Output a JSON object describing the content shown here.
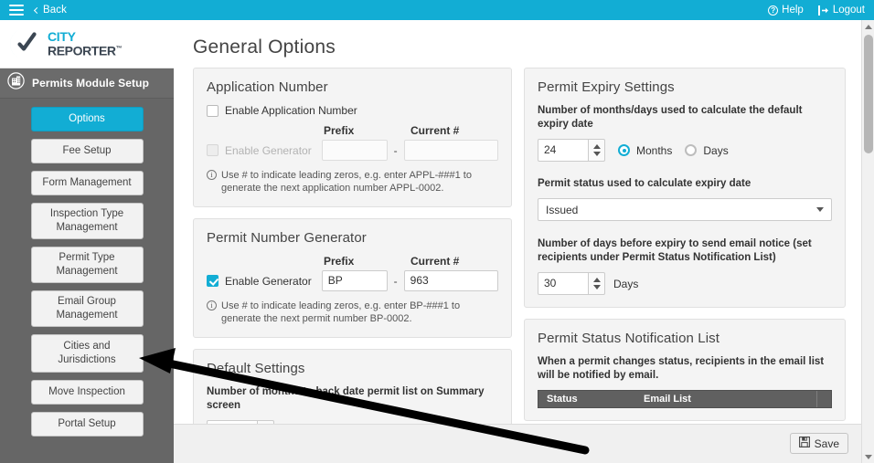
{
  "topbar": {
    "menu_icon": "hamburger-icon",
    "back_label": "Back",
    "help_label": "Help",
    "help_icon": "question-circle-icon",
    "logout_label": "Logout",
    "logout_icon": "logout-icon",
    "background_color": "#12ADD4"
  },
  "brand": {
    "line1": "CITY",
    "line2": "REPORTER",
    "trademark": "™",
    "accent_color": "#12ADD4",
    "dark_color": "#3b4652"
  },
  "sidebar": {
    "module_title": "Permits Module Setup",
    "module_icon": "building-icon",
    "background_color": "#666666",
    "items": [
      {
        "label": "Options",
        "active": true
      },
      {
        "label": "Fee Setup",
        "active": false
      },
      {
        "label": "Form Management",
        "active": false
      },
      {
        "label": "Inspection Type Management",
        "active": false
      },
      {
        "label": "Permit Type Management",
        "active": false
      },
      {
        "label": "Email Group Management",
        "active": false
      },
      {
        "label": "Cities and Jurisdictions",
        "active": false
      },
      {
        "label": "Move Inspection",
        "active": false
      },
      {
        "label": "Portal Setup",
        "active": false
      }
    ]
  },
  "page": {
    "title": "General Options"
  },
  "application_number": {
    "panel_title": "Application Number",
    "enable_label": "Enable Application Number",
    "enable_checked": false,
    "generator_label": "Enable Generator",
    "generator_checked": false,
    "generator_disabled": true,
    "prefix_label": "Prefix",
    "current_label": "Current #",
    "prefix_value": "",
    "current_value": "",
    "separator": "-",
    "hint": "Use # to indicate leading zeros, e.g. enter APPL-###1 to generate the next application number APPL-0002."
  },
  "permit_number_generator": {
    "panel_title": "Permit Number Generator",
    "generator_label": "Enable Generator",
    "generator_checked": true,
    "prefix_label": "Prefix",
    "current_label": "Current #",
    "prefix_value": "BP",
    "current_value": "963",
    "separator": "-",
    "hint": "Use # to indicate leading zeros, e.g. enter BP-###1 to generate the next permit number BP-0002."
  },
  "default_settings": {
    "panel_title": "Default Settings",
    "backdate_label": "Number of months to back date permit list on Summary screen",
    "backdate_value": ""
  },
  "permit_expiry": {
    "panel_title": "Permit Expiry Settings",
    "months_days_label": "Number of months/days used to calculate the default expiry date",
    "months_days_value": "24",
    "months_label": "Months",
    "days_label": "Days",
    "unit_selected": "Months",
    "status_label": "Permit status used to calculate expiry date",
    "status_value": "Issued",
    "email_notice_label": "Number of days before expiry to send email notice (set recipients under Permit Status Notification List)",
    "email_notice_value": "30",
    "email_notice_unit": "Days"
  },
  "notification_list": {
    "panel_title": "Permit Status Notification List",
    "description": "When a permit changes status, recipients in the email list will be notified by email.",
    "columns": [
      "Status",
      "Email List"
    ],
    "rows": []
  },
  "footer": {
    "save_label": "Save",
    "save_icon": "floppy-disk-icon"
  },
  "scrollbar": {
    "up_icon": "chevron-up-icon",
    "down_icon": "chevron-down-icon"
  }
}
